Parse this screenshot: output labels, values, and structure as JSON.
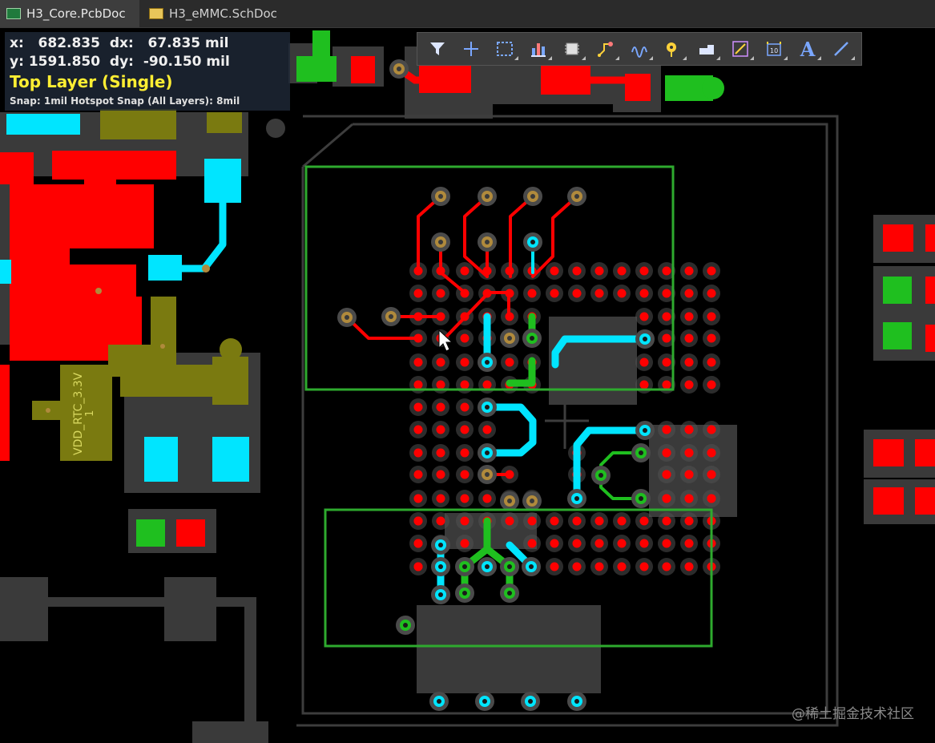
{
  "tabs": [
    {
      "label": "H3_Core.PcbDoc",
      "icon": "pcb-doc-icon",
      "active": true
    },
    {
      "label": "H3_eMMC.SchDoc",
      "icon": "sch-doc-icon",
      "active": false
    }
  ],
  "hud": {
    "x_label": "x:",
    "x_value": "682.835",
    "dx_label": "dx:",
    "dx_value": "67.835 mil",
    "y_label": "y:",
    "y_value": "1591.850",
    "dy_label": "dy:",
    "dy_value": "-90.150 mil",
    "layer": "Top Layer (Single)",
    "snap": "Snap: 1mil Hotspot Snap (All Layers): 8mil"
  },
  "toolbar": {
    "tools": [
      "filter-icon",
      "crosshair-icon",
      "selection-rect-icon",
      "chart-icon",
      "component-icon",
      "interactive-routing-icon",
      "differential-pair-icon",
      "via-icon",
      "fill-icon",
      "line-route-icon",
      "designator-icon",
      "text-icon",
      "line-icon"
    ],
    "text_tool_glyph": "A"
  },
  "board": {
    "net_label_pin": "1",
    "net_label_name": "VDD_RTC_3.3V",
    "colors": {
      "top_layer": "#ff0000",
      "bottom_layer": "#00e5ff",
      "mid_layer": "#1fbf1f",
      "power_net": "#7a7a10",
      "pad_ring": "#505050",
      "selection_box": "#2eaa2e"
    }
  },
  "watermark": "@稀土掘金技术社区"
}
